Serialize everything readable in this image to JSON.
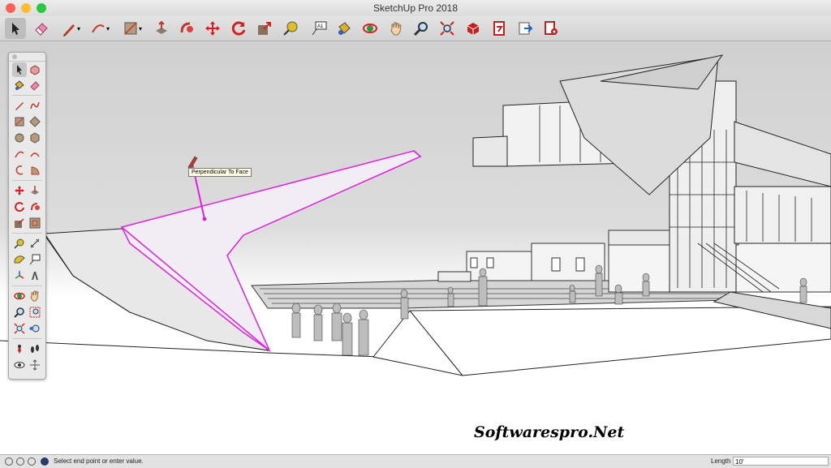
{
  "window": {
    "title": "SketchUp Pro 2018",
    "traffic_lights": [
      "#fd5f57",
      "#febc2e",
      "#28c840"
    ]
  },
  "toolbar": {
    "items": [
      {
        "name": "select-tool",
        "icon": "arrow-cursor-icon",
        "selected": true
      },
      {
        "name": "eraser-tool",
        "icon": "eraser-icon"
      },
      {
        "name": "line-tool",
        "icon": "pencil-icon",
        "dropdown": true
      },
      {
        "name": "arc-tool",
        "icon": "arc-icon",
        "dropdown": true
      },
      {
        "name": "shape-tool",
        "icon": "rectangle-icon",
        "dropdown": true
      },
      {
        "name": "push-pull-tool",
        "icon": "push-pull-icon"
      },
      {
        "name": "follow-me-tool",
        "icon": "follow-me-icon"
      },
      {
        "name": "move-tool",
        "icon": "move-icon"
      },
      {
        "name": "rotate-tool",
        "icon": "rotate-icon"
      },
      {
        "name": "scale-tool",
        "icon": "scale-icon"
      },
      {
        "name": "tape-measure-tool",
        "icon": "tape-measure-icon"
      },
      {
        "name": "text-tool",
        "icon": "text-icon"
      },
      {
        "name": "paint-bucket-tool",
        "icon": "paint-bucket-icon"
      },
      {
        "name": "orbit-tool",
        "icon": "orbit-icon"
      },
      {
        "name": "pan-tool",
        "icon": "hand-icon"
      },
      {
        "name": "zoom-tool",
        "icon": "zoom-icon"
      },
      {
        "name": "zoom-extents-tool",
        "icon": "zoom-extents-icon"
      },
      {
        "name": "3d-warehouse-button",
        "icon": "warehouse-icon"
      },
      {
        "name": "extension-warehouse-button",
        "icon": "extension-icon"
      },
      {
        "name": "send-to-layout-button",
        "icon": "layout-icon"
      },
      {
        "name": "extension-manager-button",
        "icon": "extension-manager-icon"
      }
    ]
  },
  "tool_palette": {
    "rows": [
      [
        "select",
        "component"
      ],
      [
        "paint-bucket",
        "eraser"
      ],
      [
        "line",
        "freehand"
      ],
      [
        "rectangle",
        "rotated-rectangle"
      ],
      [
        "circle",
        "polygon"
      ],
      [
        "arc",
        "two-point-arc"
      ],
      [
        "three-point-arc",
        "pie"
      ],
      [
        "move",
        "push-pull"
      ],
      [
        "rotate",
        "follow-me"
      ],
      [
        "scale",
        "offset"
      ],
      [
        "tape-measure",
        "dimension"
      ],
      [
        "protractor",
        "text"
      ],
      [
        "axes",
        "3d-text"
      ],
      [
        "orbit",
        "pan"
      ],
      [
        "zoom",
        "zoom-window"
      ],
      [
        "zoom-extents",
        "previous"
      ],
      [
        "position-camera",
        "walk"
      ],
      [
        "look-around",
        "section-plane"
      ]
    ]
  },
  "viewport": {
    "inference_tooltip": "Perpendicular To Face",
    "inference_color": "#e020e0"
  },
  "watermark": "Softwarespro.Net",
  "statusbar": {
    "message": "Select end point or enter value.",
    "measurement_label": "Length",
    "measurement_value": "10'"
  }
}
